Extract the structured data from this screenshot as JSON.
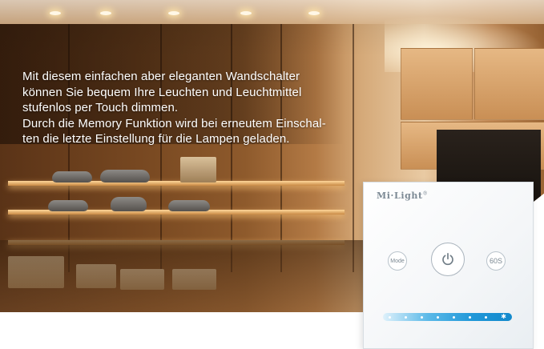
{
  "description_lines": [
    "Mit diesem einfachen aber eleganten Wandschalter",
    "können Sie bequem Ihre Leuchten und Leuchtmittel",
    "stufenlos per Touch dimmen.",
    "Durch die Memory Funktion wird bei erneutem Einschal-",
    "ten die letzte Einstellung für die Lampen geladen."
  ],
  "panel": {
    "brand": "Mi·Light",
    "brand_mark": "®",
    "mode_label": "Mode",
    "power_icon": "power-icon",
    "timer_label": "60S",
    "slider_end_icon": "sun-icon"
  },
  "colors": {
    "slider_start": "#dff1fb",
    "slider_end": "#1389cc",
    "brand_text": "#7d8a95",
    "copy_text": "#ffffff"
  }
}
